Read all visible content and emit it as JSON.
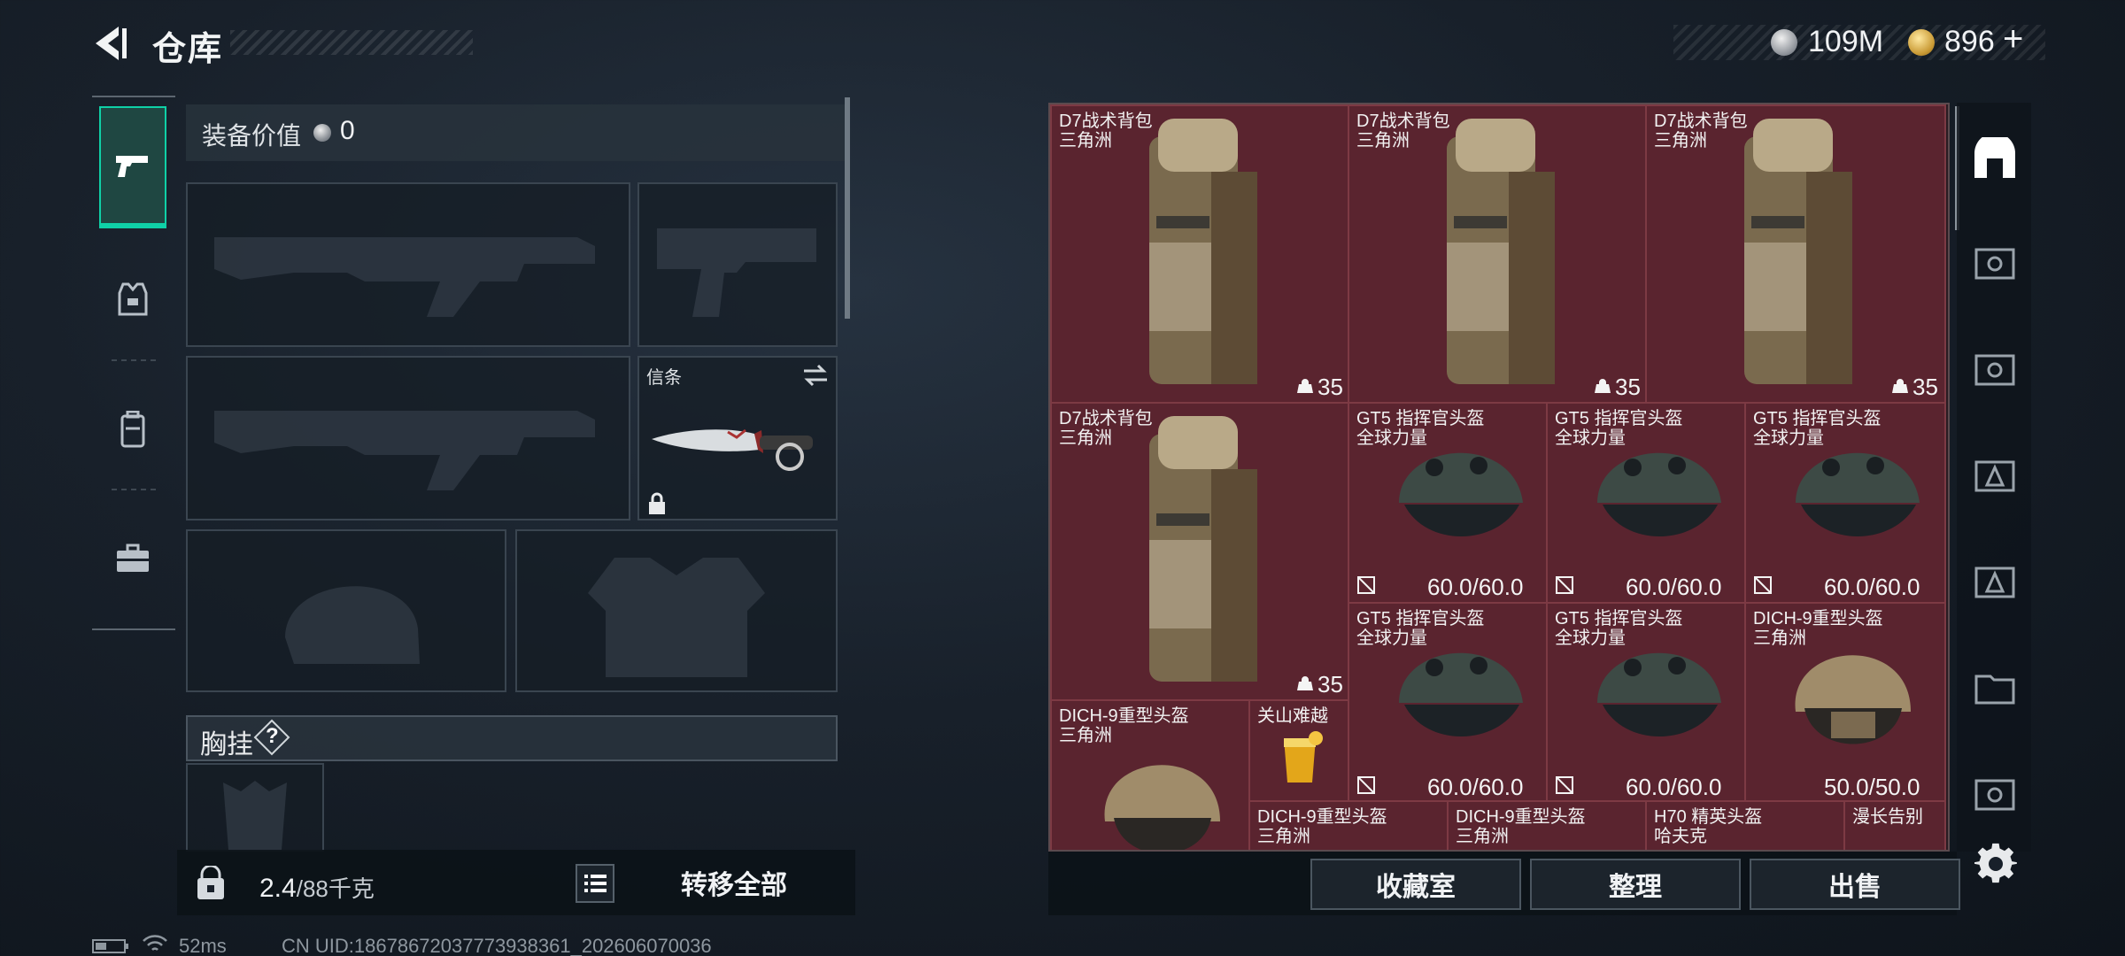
{
  "header": {
    "title": "仓库",
    "currency_silver": "109M",
    "currency_gold": "896",
    "plus": "+"
  },
  "loadout": {
    "equipment_value_label": "装备价值",
    "equipment_value": "0",
    "knife_slot_label": "信条",
    "chest_rig_label": "胸挂",
    "chest_rig_help": "?"
  },
  "footer": {
    "weight_current": "2.4",
    "weight_max": "/88千克",
    "transfer_all": "转移全部"
  },
  "stash": {
    "items": [
      {
        "name": "D7战术背包",
        "sub": "三角洲",
        "count": "35"
      },
      {
        "name": "D7战术背包",
        "sub": "三角洲",
        "count": "35"
      },
      {
        "name": "D7战术背包",
        "sub": "三角洲",
        "count": "35"
      },
      {
        "name": "D7战术背包",
        "sub": "三角洲",
        "count": "35"
      },
      {
        "name": "GT5 指挥官头盔",
        "sub": "全球力量",
        "durability": "60.0/60.0"
      },
      {
        "name": "GT5 指挥官头盔",
        "sub": "全球力量",
        "durability": "60.0/60.0"
      },
      {
        "name": "GT5 指挥官头盔",
        "sub": "全球力量",
        "durability": "60.0/60.0"
      },
      {
        "name": "GT5 指挥官头盔",
        "sub": "全球力量",
        "durability": "60.0/60.0"
      },
      {
        "name": "GT5 指挥官头盔",
        "sub": "全球力量",
        "durability": "60.0/60.0"
      },
      {
        "name": "DICH-9重型头盔",
        "sub": "三角洲",
        "durability": "50.0/50.0"
      },
      {
        "name": "DICH-9重型头盔",
        "sub": "三角洲"
      },
      {
        "name": "关山难越",
        "sub": ""
      },
      {
        "name": "DICH-9重型头盔",
        "sub": "三角洲"
      },
      {
        "name": "DICH-9重型头盔",
        "sub": "三角洲"
      },
      {
        "name": "H70 精英头盔",
        "sub": "哈夫克"
      },
      {
        "name": "漫长告别",
        "sub": ""
      }
    ]
  },
  "actions": {
    "collection": "收藏室",
    "organize": "整理",
    "sell": "出售"
  },
  "status_bar": {
    "ping": "52ms",
    "uid": "CN UID:18678672037773938361_202606070036"
  },
  "colors": {
    "accent": "#0fd1a7",
    "item_bg": "#5a242f",
    "item_border": "#7d3a44"
  },
  "icons": [
    "back-arrow-icon",
    "silver-coin-icon",
    "gold-coin-icon",
    "pistol-icon",
    "vest-icon",
    "backpack-icon",
    "briefcase-icon",
    "safe-icon",
    "lock-icon",
    "list-icon",
    "gear-icon",
    "swap-icon",
    "battery-icon",
    "wifi-icon"
  ]
}
